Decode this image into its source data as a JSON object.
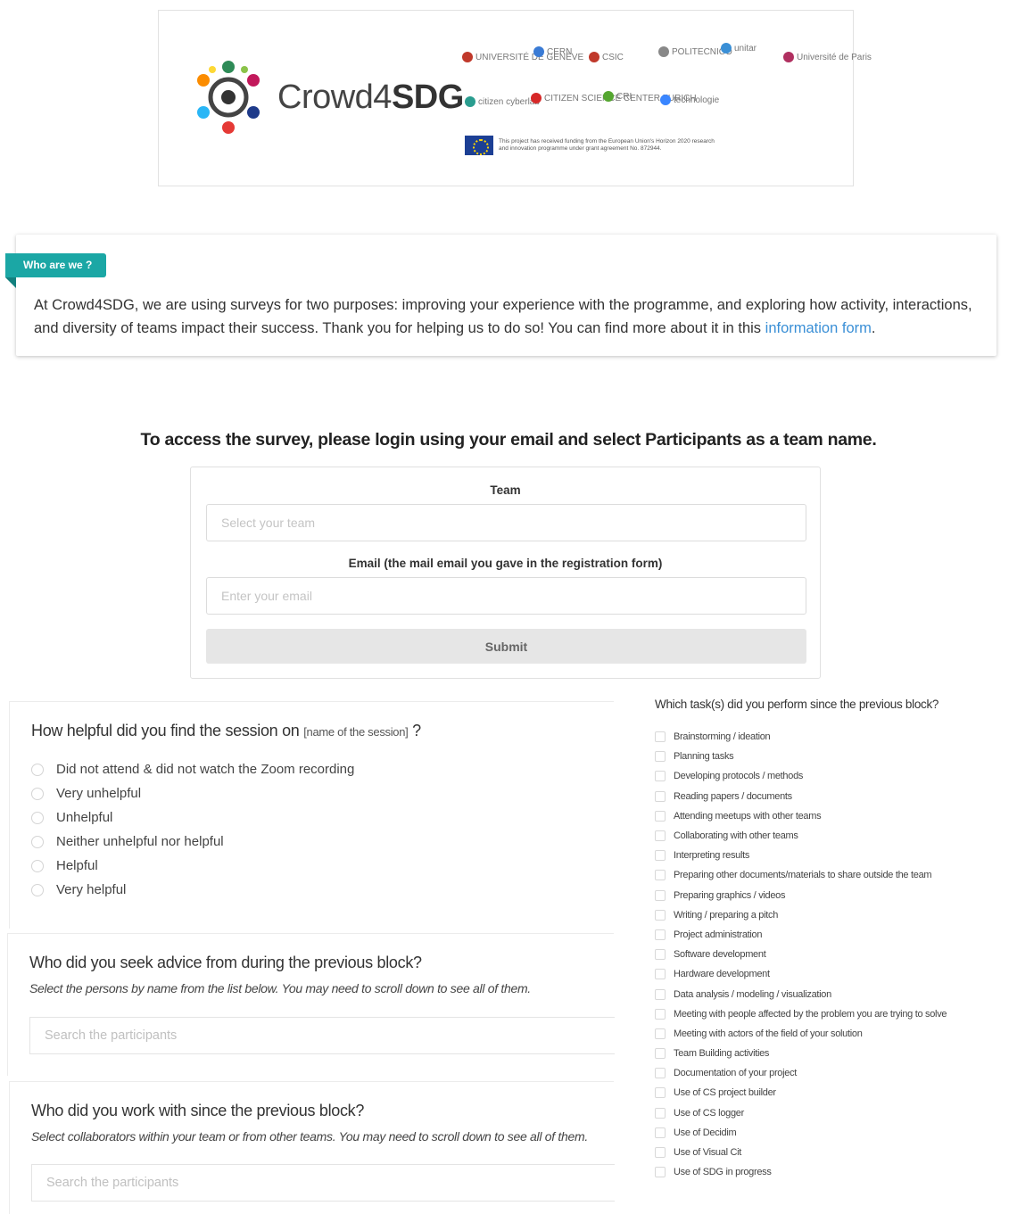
{
  "brand": {
    "name_light": "Crowd4",
    "name_bold": "SDG"
  },
  "partners": [
    {
      "label": "UNIVERSITÉ DE GENÈVE",
      "color": "#c0392b"
    },
    {
      "label": "CERN",
      "color": "#3a7bd5"
    },
    {
      "label": "CSIC",
      "color": "#c0392b"
    },
    {
      "label": "POLITECNICO",
      "color": "#888888"
    },
    {
      "label": "unitar",
      "color": "#3a8fd6"
    },
    {
      "label": "Université de Paris",
      "color": "#b03060"
    },
    {
      "label": "citizen cyberlab",
      "color": "#2a9d8f"
    },
    {
      "label": "CITIZEN SCIENCE CENTER ZURICH",
      "color": "#d62828"
    },
    {
      "label": "CRI",
      "color": "#55a630"
    },
    {
      "label": "technologie",
      "color": "#3a86ff"
    }
  ],
  "funding": {
    "text": "This project has received funding from the European Union's Horizon 2020 research and innovation programme under grant agreement No. 872944."
  },
  "who": {
    "tag": "Who are we ?",
    "text": "At Crowd4SDG, we are using surveys for two purposes: improving your experience with the programme, and exploring how activity, interactions, and diversity of teams impact their success. Thank you for helping us to do so! You can find more about it in this ",
    "link": "information form",
    "end": "."
  },
  "login": {
    "title": "To access the survey, please login using your email and select Participants as a team name.",
    "team_label": "Team",
    "team_placeholder": "Select your team",
    "email_label": "Email (the mail email you gave in the registration form)",
    "email_placeholder": "Enter your email",
    "submit": "Submit"
  },
  "q1": {
    "title": "How helpful did you find the session on ",
    "title_small": "[name of the session]",
    "title_end": " ?",
    "options": [
      "Did not attend & did not watch the Zoom recording",
      "Very unhelpful",
      "Unhelpful",
      "Neither unhelpful nor helpful",
      "Helpful",
      "Very helpful"
    ]
  },
  "q2": {
    "title": "Who did you seek advice from during the previous block?",
    "subtitle": "Select the persons by name from the list below. You may need to scroll down to see all of them.",
    "placeholder": "Search the participants"
  },
  "q3": {
    "title": "Who did you work with since the previous block?",
    "subtitle": "Select collaborators within your team or from other teams. You may need to scroll down to see all of them.",
    "placeholder": "Search the participants"
  },
  "tasks": {
    "title": "Which task(s) did you perform since the previous block?",
    "items": [
      "Brainstorming / ideation",
      "Planning tasks",
      "Developing protocols / methods",
      "Reading papers / documents",
      "Attending meetups with other teams",
      "Collaborating with other teams",
      "Interpreting results",
      "Preparing other documents/materials to share outside the team",
      "Preparing graphics / videos",
      "Writing / preparing a pitch",
      "Project administration",
      "Software development",
      "Hardware development",
      "Data analysis / modeling / visualization",
      "Meeting with people affected by the problem you are trying to solve",
      "Meeting with actors of the field of your solution",
      "Team Building activities",
      "Documentation of your project",
      "Use of CS project builder",
      "Use of CS logger",
      "Use of Decidim",
      "Use of Visual Cit",
      "Use of SDG in progress"
    ]
  }
}
